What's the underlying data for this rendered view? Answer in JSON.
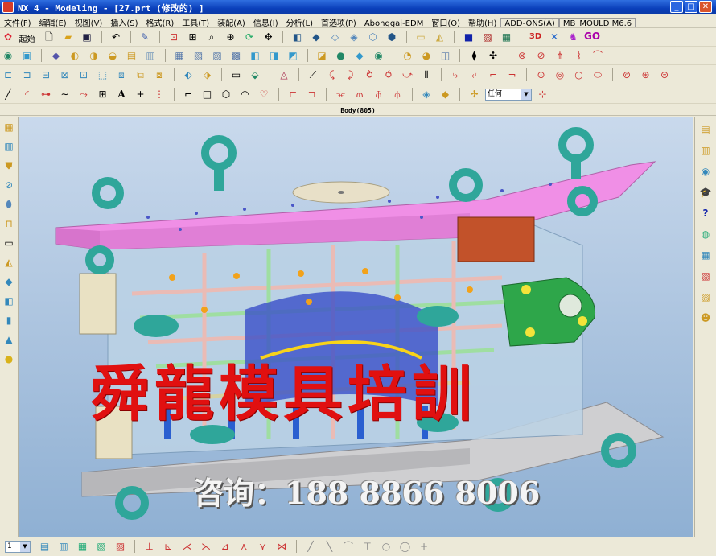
{
  "window": {
    "title": "NX 4 - Modeling - [27.prt  (修改的) ]",
    "min_label": "_",
    "max_label": "□",
    "close_label": "✕"
  },
  "menu": [
    {
      "label": "文件(F)",
      "boxed": false
    },
    {
      "label": "编辑(E)",
      "boxed": false
    },
    {
      "label": "视图(V)",
      "boxed": false
    },
    {
      "label": "插入(S)",
      "boxed": false
    },
    {
      "label": "格式(R)",
      "boxed": false
    },
    {
      "label": "工具(T)",
      "boxed": false
    },
    {
      "label": "装配(A)",
      "boxed": false
    },
    {
      "label": "信息(I)",
      "boxed": false
    },
    {
      "label": "分析(L)",
      "boxed": false
    },
    {
      "label": "首选项(P)",
      "boxed": false
    },
    {
      "label": "Abonggai-EDM",
      "boxed": false
    },
    {
      "label": "窗口(O)",
      "boxed": false
    },
    {
      "label": "帮助(H)",
      "boxed": false
    },
    {
      "label": "ADD-ONS(A)",
      "boxed": true
    },
    {
      "label": "MB_MOULD M6.6",
      "boxed": true
    }
  ],
  "toolbar": {
    "start_label": "起始",
    "filter_value": "任何",
    "go_label": "GO"
  },
  "status_line": "Body(805)",
  "layer_select_value": "1",
  "watermark": {
    "title": "舜龍模具培訓",
    "phone": "咨询：188 8866 8006"
  },
  "colors": {
    "top_plate": "#f08fe6",
    "base_plate": "#cfcfd1",
    "eyebolt": "#2fa69a",
    "watermark": "#e11010"
  }
}
